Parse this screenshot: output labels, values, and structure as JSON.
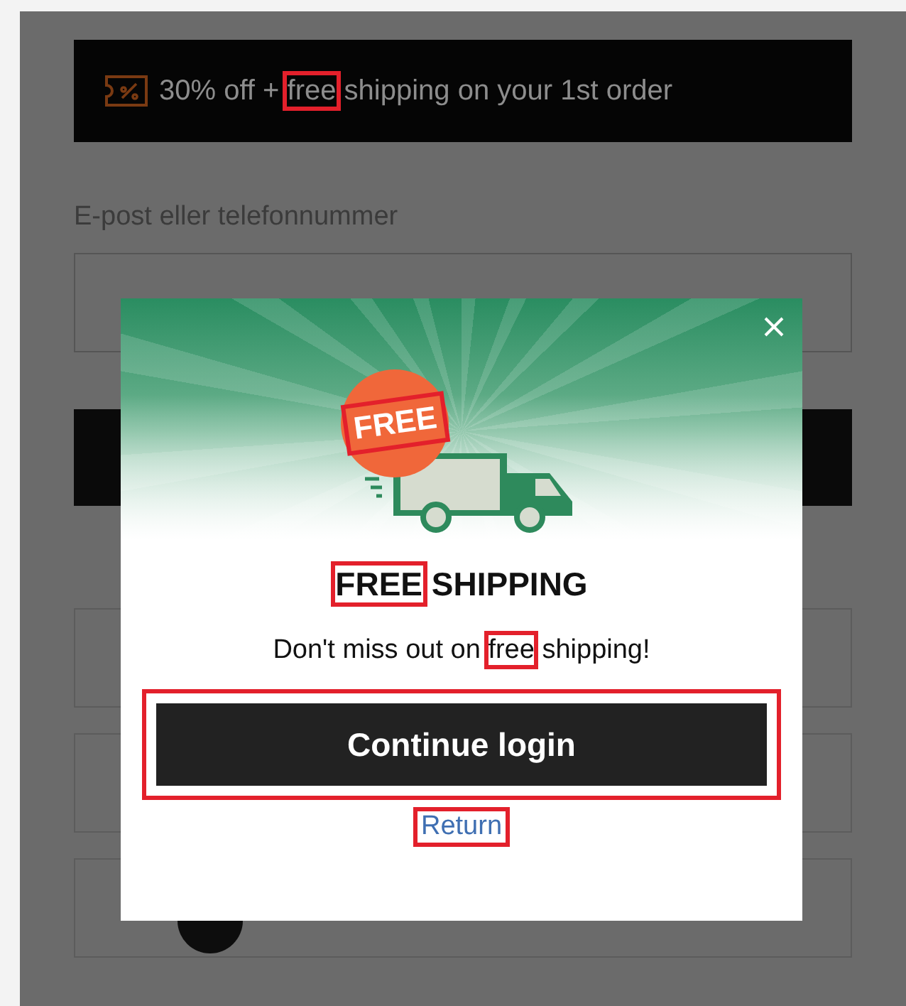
{
  "promo_banner": {
    "parts": [
      {
        "text": "30% off +",
        "highlighted": false
      },
      {
        "text": "free",
        "highlighted": true
      },
      {
        "text": "shipping on your 1st order",
        "highlighted": false
      }
    ]
  },
  "login_form": {
    "field_label": "E-post eller telefonnummer"
  },
  "modal": {
    "illustration": {
      "badge_text": "FREE",
      "highlighted": true
    },
    "title_parts": [
      {
        "text": "FREE",
        "highlighted": true
      },
      {
        "text": "SHIPPING",
        "highlighted": false
      }
    ],
    "message_parts": [
      {
        "text": "Don't miss out on",
        "highlighted": false
      },
      {
        "text": "free",
        "highlighted": true
      },
      {
        "text": "shipping!",
        "highlighted": false
      }
    ],
    "primary_button": {
      "label": "Continue login",
      "highlighted": true
    },
    "link": {
      "label": "Return",
      "highlighted": true
    }
  }
}
